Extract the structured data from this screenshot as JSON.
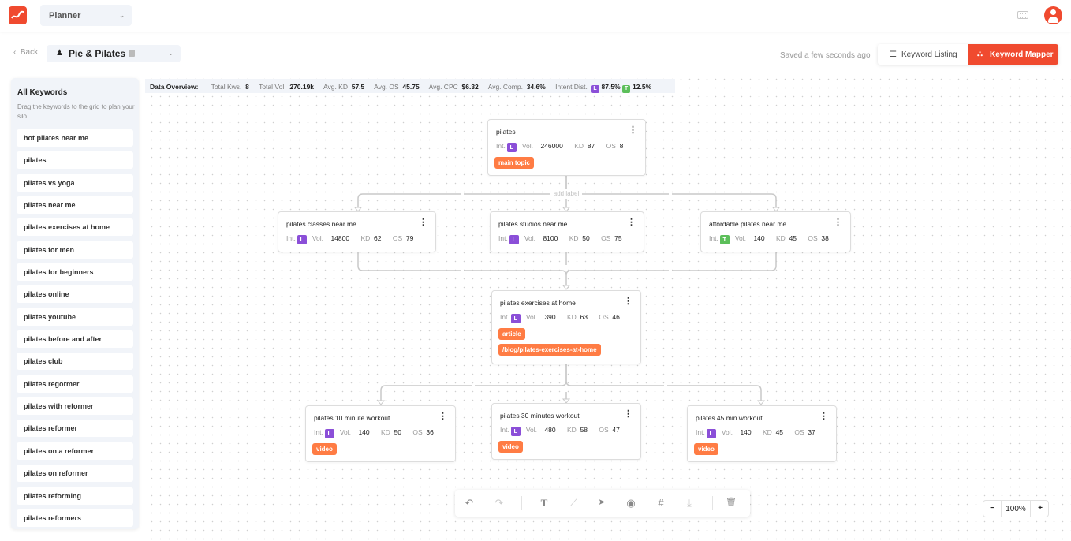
{
  "header": {
    "app_select": "Planner",
    "project_name": "Pie & Pilates",
    "back_label": "Back",
    "saved_status": "Saved a few seconds ago",
    "view_tabs": [
      {
        "label": "Keyword Listing",
        "active": false
      },
      {
        "label": "Keyword Mapper",
        "active": true
      }
    ]
  },
  "colors": {
    "brand": "#f04a2f",
    "tag": "#ff7c44",
    "intent_L": "#8b4fd8",
    "intent_T": "#5cbf5a"
  },
  "sidebar": {
    "title": "All Keywords",
    "hint": "Drag the keywords to the grid to plan your silo",
    "keywords": [
      "hot pilates near me",
      "pilates",
      "pilates vs yoga",
      "pilates near me",
      "pilates exercises at home",
      "pilates for men",
      "pilates for beginners",
      "pilates online",
      "pilates youtube",
      "pilates before and after",
      "pilates club",
      "pilates regormer",
      "pilates with reformer",
      "pilates reformer",
      "pilates on a reformer",
      "pilates on reformer",
      "pilates reforming",
      "pilates reformers"
    ]
  },
  "overview": {
    "label": "Data Overview:",
    "total_kws_label": "Total Kws.",
    "total_kws": "8",
    "total_vol_label": "Total Vol.",
    "total_vol": "270.19k",
    "avg_kd_label": "Avg. KD",
    "avg_kd": "57.5",
    "avg_os_label": "Avg. OS",
    "avg_os": "45.75",
    "avg_cpc_label": "Avg. CPC",
    "avg_cpc": "$6.32",
    "avg_comp_label": "Avg. Comp.",
    "avg_comp": "34.6%",
    "intent_label": "Intent Dist.",
    "intent_L_badge": "L",
    "intent_L": "87.5%",
    "intent_T_badge": "T",
    "intent_T": "12.5%"
  },
  "labels": {
    "int": "Int.",
    "vol": "Vol.",
    "kd": "KD",
    "os": "OS",
    "edge_label": "add label",
    "menu": "⋮"
  },
  "nodes": [
    {
      "title": "pilates",
      "intent": "L",
      "vol": "246000",
      "kd": "87",
      "os": "8",
      "tags": [
        "main topic"
      ]
    },
    {
      "title": "pilates classes near me",
      "intent": "L",
      "vol": "14800",
      "kd": "62",
      "os": "79",
      "tags": []
    },
    {
      "title": "pilates studios near me",
      "intent": "L",
      "vol": "8100",
      "kd": "50",
      "os": "75",
      "tags": []
    },
    {
      "title": "affordable pilates near me",
      "intent": "T",
      "vol": "140",
      "kd": "45",
      "os": "38",
      "tags": []
    },
    {
      "title": "pilates exercises at home",
      "intent": "L",
      "vol": "390",
      "kd": "63",
      "os": "46",
      "tags": [
        "article",
        "/blog/pilates-exercises-at-home"
      ]
    },
    {
      "title": "pilates 10 minute workout",
      "intent": "L",
      "vol": "140",
      "kd": "50",
      "os": "36",
      "tags": [
        "video"
      ]
    },
    {
      "title": "pilates 30 minutes workout",
      "intent": "L",
      "vol": "480",
      "kd": "58",
      "os": "47",
      "tags": [
        "video"
      ]
    },
    {
      "title": "pilates 45 min workout",
      "intent": "L",
      "vol": "140",
      "kd": "45",
      "os": "37",
      "tags": [
        "video"
      ]
    }
  ],
  "toolbar": {
    "tools": [
      {
        "name": "undo",
        "glyph": "↶"
      },
      {
        "name": "redo",
        "glyph": "↷"
      },
      {
        "name": "text",
        "glyph": "T"
      },
      {
        "name": "connector",
        "glyph": "⟋"
      },
      {
        "name": "select",
        "glyph": "➤"
      },
      {
        "name": "preview",
        "glyph": "◉"
      },
      {
        "name": "grid",
        "glyph": "#"
      },
      {
        "name": "download",
        "glyph": "⤓"
      },
      {
        "name": "delete",
        "glyph": "🗑"
      }
    ]
  },
  "zoom": {
    "value": "100%",
    "minus": "−",
    "plus": "+"
  }
}
